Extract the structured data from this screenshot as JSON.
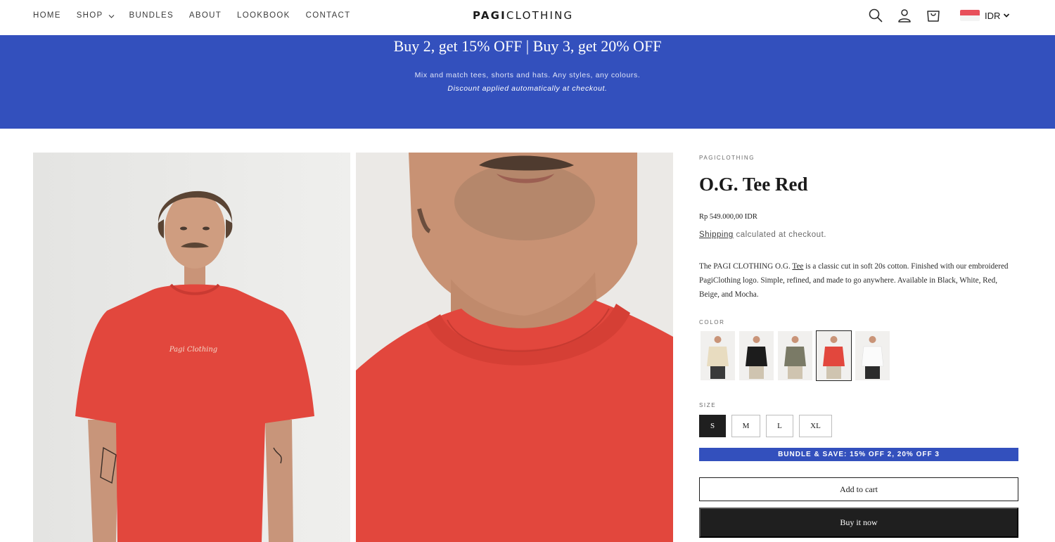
{
  "nav": {
    "items": [
      {
        "label": "HOME",
        "has_dropdown": false
      },
      {
        "label": "SHOP",
        "has_dropdown": true
      },
      {
        "label": "BUNDLES",
        "has_dropdown": false
      },
      {
        "label": "ABOUT",
        "has_dropdown": false
      },
      {
        "label": "LOOKBOOK",
        "has_dropdown": false
      },
      {
        "label": "CONTACT",
        "has_dropdown": false
      }
    ]
  },
  "brand": {
    "bold": "PAGI",
    "light": "CLOTHING"
  },
  "header": {
    "icons": [
      "search-icon",
      "account-icon",
      "cart-icon"
    ],
    "currency": "IDR"
  },
  "banner": {
    "title": "Buy 2, get 15% OFF | Buy 3, get 20% OFF",
    "subtitle": "Mix and match tees, shorts and hats. Any styles, any colours.",
    "note": "Discount applied automatically at checkout.",
    "color": "#3350bd"
  },
  "product": {
    "vendor": "PAGICLOTHING",
    "title": "O.G. Tee Red",
    "price": "Rp 549.000,00 IDR",
    "shipping_link": "Shipping",
    "shipping_text": "calculated at checkout.",
    "description_before": "The PAGI CLOTHING O.G. ",
    "description_underlined": "Tee",
    "description_after": " is a classic cut in soft 20s cotton. Finished with our embroidered PagiClothing logo. Simple, refined, and made to go anywhere. Available in Black, White, Red, Beige, and Mocha.",
    "shirt_color": "#e2473d",
    "color_label": "COLOR",
    "colors": [
      {
        "name": "Beige",
        "hex": "#e8dcc0",
        "selected": false
      },
      {
        "name": "Black",
        "hex": "#1c1c1c",
        "selected": false
      },
      {
        "name": "Mocha",
        "hex": "#7a7a66",
        "selected": false
      },
      {
        "name": "Red",
        "hex": "#e2473d",
        "selected": true
      },
      {
        "name": "White",
        "hex": "#f4f4f4",
        "selected": false
      }
    ],
    "size_label": "SIZE",
    "sizes": [
      {
        "label": "S",
        "selected": true
      },
      {
        "label": "M",
        "selected": false
      },
      {
        "label": "L",
        "selected": false
      },
      {
        "label": "XL",
        "selected": false
      }
    ],
    "bundle_label": "BUNDLE & SAVE: 15% OFF 2, 20% OFF 3",
    "add_to_cart": "Add to cart",
    "buy_now": "Buy it now"
  }
}
